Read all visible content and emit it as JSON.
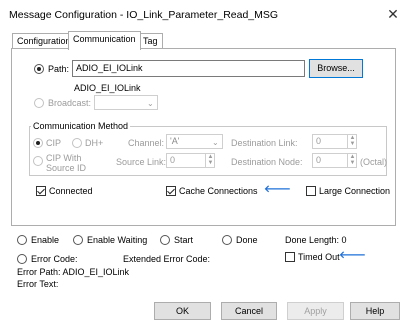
{
  "window": {
    "title": "Message Configuration - IO_Link_Parameter_Read_MSG",
    "close_glyph": "✕"
  },
  "tabs": [
    {
      "label": "Configuration",
      "active": false
    },
    {
      "label": "Communication",
      "active": true
    },
    {
      "label": "Tag",
      "active": false
    }
  ],
  "path": {
    "label": "Path:",
    "value": "ADIO_EI_IOLink",
    "resolved": "ADIO_EI_IOLink",
    "browse_label": "Browse..."
  },
  "broadcast": {
    "label": "Broadcast:",
    "value": ""
  },
  "comm_method": {
    "title": "Communication Method",
    "cip_label": "CIP",
    "dh_label": "DH+",
    "channel_label": "Channel:",
    "channel_value": "'A'",
    "dest_link_label": "Destination Link:",
    "dest_link_value": "0",
    "cip_source_label_1": "CIP With",
    "cip_source_label_2": "Source ID",
    "source_link_label": "Source Link:",
    "source_link_value": "0",
    "dest_node_label": "Destination Node:",
    "dest_node_value": "0",
    "octal_label": "(Octal)"
  },
  "options": {
    "connected_label": "Connected",
    "connected_checked": true,
    "cache_label": "Cache Connections",
    "cache_checked": true,
    "large_label": "Large Connection",
    "large_checked": false,
    "arrow_glyph": "🡐"
  },
  "status": {
    "enable": "Enable",
    "enable_waiting": "Enable Waiting",
    "start": "Start",
    "done": "Done",
    "done_length": "Done Length: 0",
    "error_code": "Error Code:",
    "extended_error_code": "Extended Error Code:",
    "timed_out": "Timed Out",
    "error_path": "Error Path: ADIO_EI_IOLink",
    "error_text": "Error Text:"
  },
  "buttons": {
    "ok": "OK",
    "cancel": "Cancel",
    "apply": "Apply",
    "help": "Help"
  },
  "colors": {
    "accent_blue": "#1e6fd9",
    "focus_border": "#0078d7"
  }
}
